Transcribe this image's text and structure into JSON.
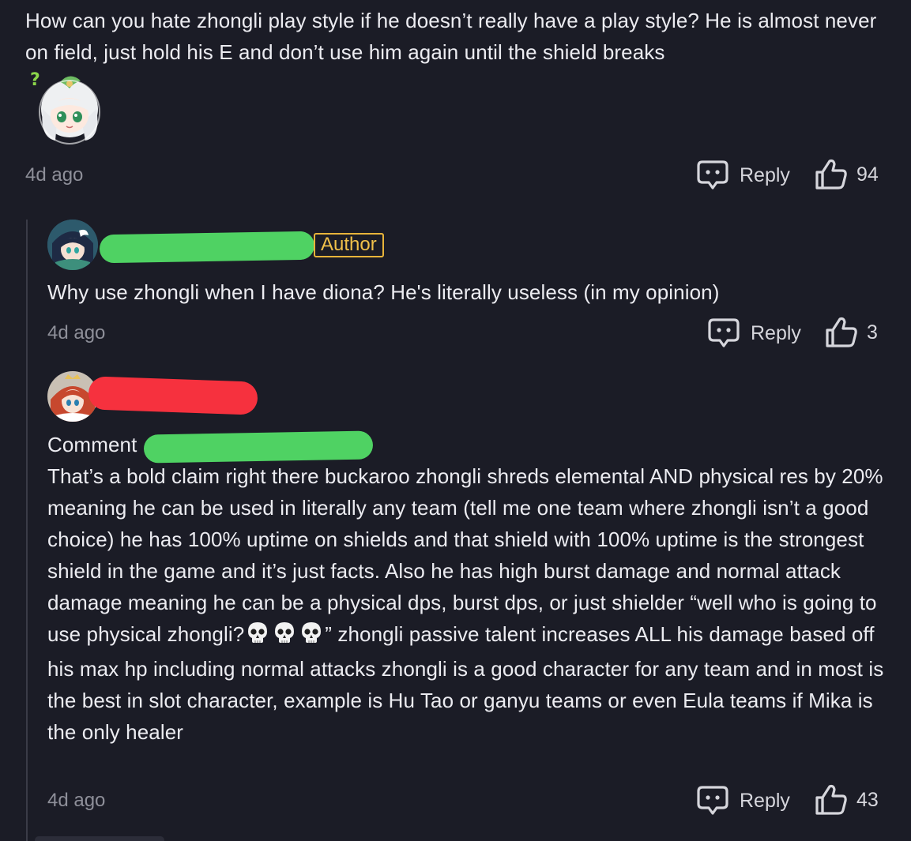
{
  "colors": {
    "background": "#1b1c26",
    "redact_green": "#4fd263",
    "redact_red": "#f6313e",
    "author_badge": "#e8b43a"
  },
  "comment1": {
    "text": "How can you hate zhongli play style if he doesn’t really have a play style? He is almost never on field, just hold his E and don’t use him again until the shield breaks",
    "sticker": "chibi-character-question-sticker",
    "time": "4d ago",
    "reply_label": "Reply",
    "likes": "94"
  },
  "reply1": {
    "avatar": "character-avatar-blue-hair",
    "author_badge": "Author",
    "text": "Why use zhongli when I have diona? He's literally useless (in my opinion)",
    "time": "4d ago",
    "reply_label": "Reply",
    "likes": "3"
  },
  "reply2": {
    "avatar": "character-avatar-red-hair",
    "reply_to_prefix": "Comment",
    "paragraph_start": "That’s a bold claim right there buckaroo zhongli shreds elemental AND physical res by 20% meaning he can be used in literally any team (tell me one team where zhongli isn’t a good choice) he has 100% uptime on shields and that shield with 100% uptime is the strongest shield in the game and it’s just facts. Also he has high burst damage and normal attack damage meaning he can be a physical dps, burst dps, or just shielder “well who is going to use physical zhongli?",
    "paragraph_end": "” zhongli passive talent increases ALL his damage based off his max hp including normal attacks zhongli is a good character for any team and in most is the best in slot character, example is Hu Tao or ganyu teams or even Eula teams if Mika is the only healer",
    "skull_icons": [
      "skull-icon",
      "skull-icon",
      "skull-icon"
    ],
    "time": "4d ago",
    "reply_label": "Reply",
    "likes": "43"
  }
}
